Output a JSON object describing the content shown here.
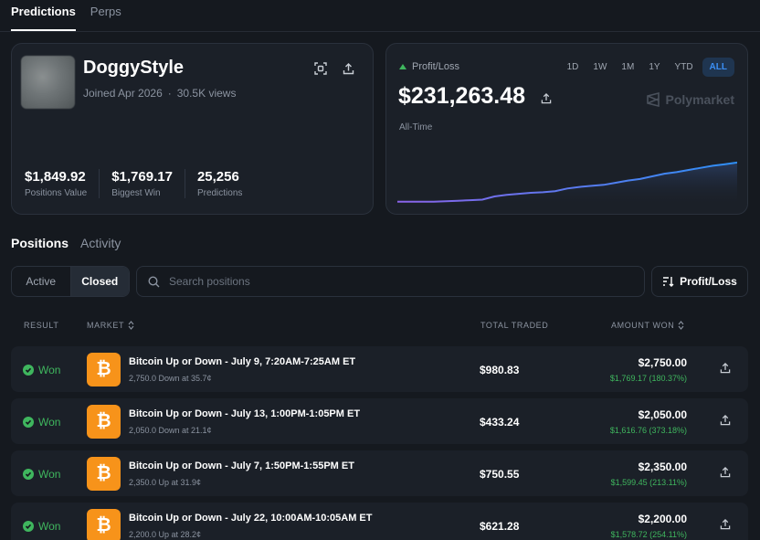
{
  "top_tabs": [
    "Predictions",
    "Perps"
  ],
  "profile": {
    "username": "DoggyStyle",
    "joined": "Joined Apr 2026",
    "views": "30.5K views",
    "stats": [
      {
        "value": "$1,849.92",
        "label": "Positions Value"
      },
      {
        "value": "$1,769.17",
        "label": "Biggest Win"
      },
      {
        "value": "25,256",
        "label": "Predictions"
      }
    ]
  },
  "pnl": {
    "title": "Profit/Loss",
    "ranges": [
      "1D",
      "1W",
      "1M",
      "1Y",
      "YTD",
      "ALL"
    ],
    "active_range": "ALL",
    "value": "$231,263.48",
    "brand": "Polymarket",
    "period": "All-Time",
    "trend": [
      0.02,
      0.02,
      0.02,
      0.02,
      0.03,
      0.04,
      0.05,
      0.06,
      0.12,
      0.15,
      0.17,
      0.19,
      0.2,
      0.22,
      0.27,
      0.3,
      0.32,
      0.34,
      0.38,
      0.42,
      0.45,
      0.5,
      0.55,
      0.58,
      0.62,
      0.66,
      0.7,
      0.73,
      0.76
    ]
  },
  "section_tabs": [
    "Positions",
    "Activity"
  ],
  "filters": {
    "segments": [
      "Active",
      "Closed"
    ],
    "active_segment": "Closed",
    "search_placeholder": "Search positions",
    "sort_label": "Profit/Loss"
  },
  "table": {
    "headers": {
      "result": "RESULT",
      "market": "MARKET",
      "total_traded": "TOTAL TRADED",
      "amount_won": "AMOUNT WON"
    },
    "rows": [
      {
        "result": "Won",
        "title": "Bitcoin Up or Down - July 9, 7:20AM-7:25AM ET",
        "sub": "2,750.0 Down at 35.7¢",
        "traded": "$980.83",
        "amount": "$2,750.00",
        "gain": "$1,769.17 (180.37%)"
      },
      {
        "result": "Won",
        "title": "Bitcoin Up or Down - July 13, 1:00PM-1:05PM ET",
        "sub": "2,050.0 Down at 21.1¢",
        "traded": "$433.24",
        "amount": "$2,050.00",
        "gain": "$1,616.76 (373.18%)"
      },
      {
        "result": "Won",
        "title": "Bitcoin Up or Down - July 7, 1:50PM-1:55PM ET",
        "sub": "2,350.0 Up at 31.9¢",
        "traded": "$750.55",
        "amount": "$2,350.00",
        "gain": "$1,599.45 (213.11%)"
      },
      {
        "result": "Won",
        "title": "Bitcoin Up or Down - July 22, 10:00AM-10:05AM ET",
        "sub": "2,200.0 Up at 28.2¢",
        "traded": "$621.28",
        "amount": "$2,200.00",
        "gain": "$1,578.72 (254.11%)"
      }
    ]
  },
  "colors": {
    "accent": "#3b8ff5",
    "positive": "#3fb65e",
    "bitcoin": "#f7931a",
    "background": "#15191f"
  }
}
